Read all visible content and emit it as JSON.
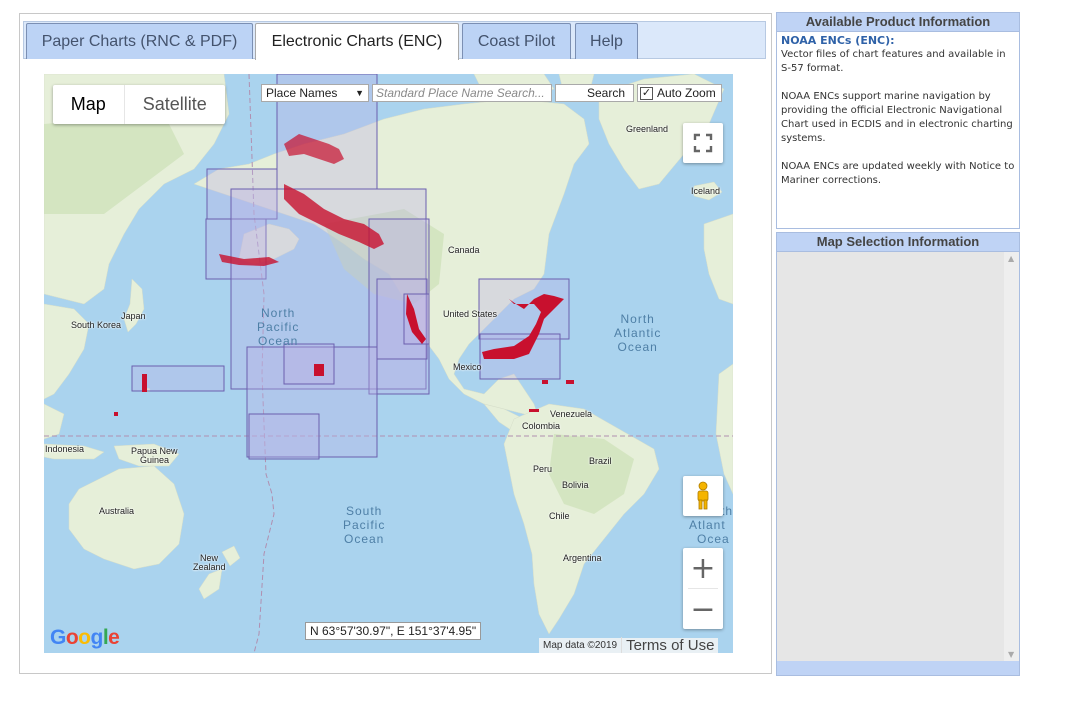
{
  "tabs": [
    {
      "label": "Paper Charts (RNC & PDF)",
      "active": false
    },
    {
      "label": "Electronic Charts (ENC)",
      "active": true
    },
    {
      "label": "Coast Pilot",
      "active": false
    },
    {
      "label": "Help",
      "active": false
    }
  ],
  "map": {
    "maptype": {
      "map": "Map",
      "satellite": "Satellite"
    },
    "place_select": "Place Names",
    "search_placeholder": "Standard Place Name Search...",
    "search_button": "Search",
    "auto_zoom": "Auto Zoom",
    "auto_zoom_checked": true,
    "coordinates": "N 63°57'30.97\",  E  151°37'4.95\"",
    "attribution": "Map data ©2019",
    "terms": "Terms of Use",
    "google_logo": "Google",
    "labels": {
      "greenland": "Greenland",
      "iceland": "Iceland",
      "canada": "Canada",
      "united_states": "United States",
      "mexico": "Mexico",
      "japan": "Japan",
      "south_korea": "South Korea",
      "venezuela": "Venezuela",
      "colombia": "Colombia",
      "peru": "Peru",
      "brazil": "Brazil",
      "bolivia": "Bolivia",
      "chile": "Chile",
      "argentina": "Argentina",
      "indonesia": "Indonesia",
      "papua_new_guinea_1": "Papua New",
      "papua_new_guinea_2": "Guinea",
      "australia": "Australia",
      "new_zealand_1": "New",
      "new_zealand_2": "Zealand",
      "north_pacific": [
        "North",
        "Pacific",
        "Ocean"
      ],
      "north_atlantic": [
        "North",
        "Atlantic",
        "Ocean"
      ],
      "south_pacific": [
        "South",
        "Pacific",
        "Ocean"
      ],
      "south_atlantic": [
        "th",
        "Atlant",
        "Ocea"
      ]
    }
  },
  "info_panel": {
    "title": "Available Product Information",
    "enc_title": "NOAA ENCs (ENC):",
    "p1": "Vector files of chart features and available in S-57 format.",
    "p2": "NOAA ENCs support marine navigation by providing the official Electronic Navigational Chart used in ECDIS and in electronic charting systems.",
    "p3": "NOAA ENCs are updated weekly with Notice to Mariner corrections."
  },
  "selection_panel": {
    "title": "Map Selection Information"
  },
  "colors": {
    "water": "#aad3ee",
    "land": "#e6efd9",
    "chart_outline": "#6b5fae",
    "chart_fill": "#b9b3e6",
    "chart_coverage": "#c8102e",
    "tab_bg": "#bcd3f5",
    "panel_header": "#bfd3f5"
  }
}
